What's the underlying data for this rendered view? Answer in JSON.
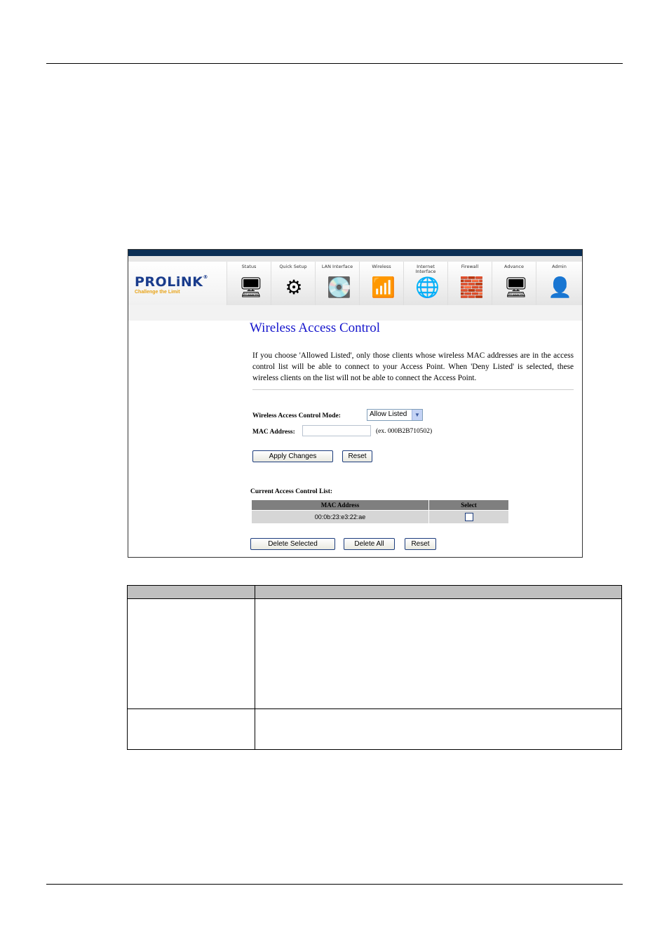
{
  "header": {},
  "router": {
    "logo": {
      "brand": "PROLiNK",
      "registered": "®",
      "tagline": "Challenge the Limit"
    },
    "nav": [
      {
        "label": "Status",
        "icon": "monitor-icon",
        "glyph": "🖥"
      },
      {
        "label": "Quick Setup",
        "icon": "gear-icon",
        "glyph": "⚙"
      },
      {
        "label": "LAN Interface",
        "icon": "network-drive-icon",
        "glyph": "💽"
      },
      {
        "label": "Wireless",
        "icon": "wireless-adapter-icon",
        "glyph": "📶"
      },
      {
        "label": "Internet Interface",
        "icon": "internet-explorer-icon",
        "glyph": "🌐"
      },
      {
        "label": "Firewall",
        "icon": "firewall-icon",
        "glyph": "🧱"
      },
      {
        "label": "Advance",
        "icon": "advance-monitor-icon",
        "glyph": "🖥"
      },
      {
        "label": "Admin",
        "icon": "admin-user-icon",
        "glyph": "👤"
      }
    ],
    "page_title": "Wireless Access Control",
    "description": "If you choose 'Allowed Listed', only those clients whose wireless MAC addresses are in the access control list will be able to connect to your Access Point. When 'Deny Listed' is selected, these wireless clients on the list will not be able to connect the Access Point.",
    "mode_label": "Wireless Access Control Mode:",
    "mode_value": "Allow Listed",
    "mac_label": "MAC Address:",
    "mac_value": "",
    "mac_hint": "(ex. 000B2B710502)",
    "apply_label": "Apply Changes",
    "reset_label": "Reset",
    "list_label": "Current Access Control List:",
    "table": {
      "headers": [
        "MAC Address",
        "Select"
      ],
      "rows": [
        {
          "mac": "00:0b:23:e3:22:ae",
          "selected": false
        }
      ]
    },
    "delete_selected_label": "Delete Selected",
    "delete_all_label": "Delete All",
    "reset2_label": "Reset"
  },
  "definition_table": {
    "headers": [
      "",
      ""
    ],
    "rows": [
      [
        "",
        ""
      ],
      [
        "",
        ""
      ]
    ]
  }
}
